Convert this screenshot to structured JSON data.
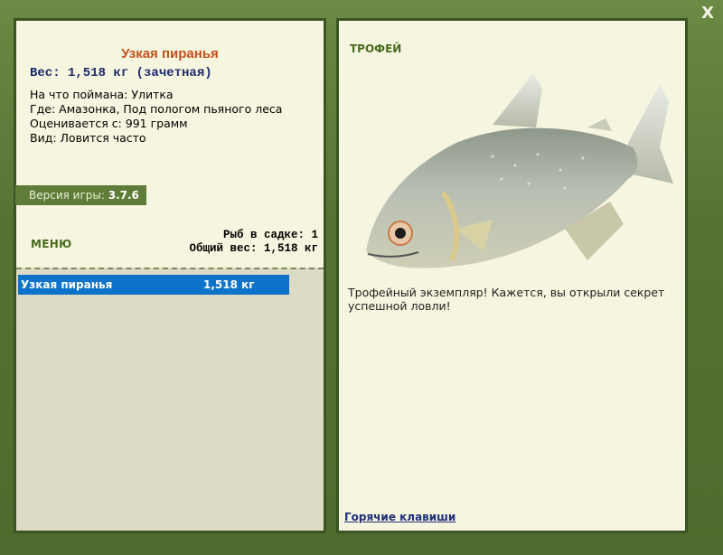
{
  "window": {
    "close_label": "X"
  },
  "fish": {
    "name": "Узкая пиранья",
    "weight_line": "Вес: 1,518 кг (зачетная)",
    "caught_on": "На что поймана: Улитка",
    "location": "Где: Амазонка, Под пологом пьяного леса",
    "rated_from": "Оценивается с: 991 грамм",
    "kind": "Вид: Ловится часто"
  },
  "version": {
    "label": "Версия игры:",
    "value": "3.7.6"
  },
  "menu": {
    "label": "МЕНЮ"
  },
  "stats": {
    "fish_count": "Рыб в садке: 1",
    "total_weight": "Общий вес: 1,518 кг"
  },
  "catch_list": [
    {
      "name": "Узкая пиранья",
      "weight": "1,518 кг"
    }
  ],
  "trophy": {
    "label": "ТРОФЕЙ",
    "text": "Трофейный экземпляр! Кажется, вы открыли секрет успешной ловли!",
    "image": "piranha-photo"
  },
  "footer": {
    "hotkeys_link": "Горячие клавиши"
  },
  "colors": {
    "frame": "#5e7a3a",
    "panel": "#f6f5df",
    "fish_title": "#c0501c",
    "weight": "#1c2a6e",
    "selection": "#0d72c9"
  }
}
